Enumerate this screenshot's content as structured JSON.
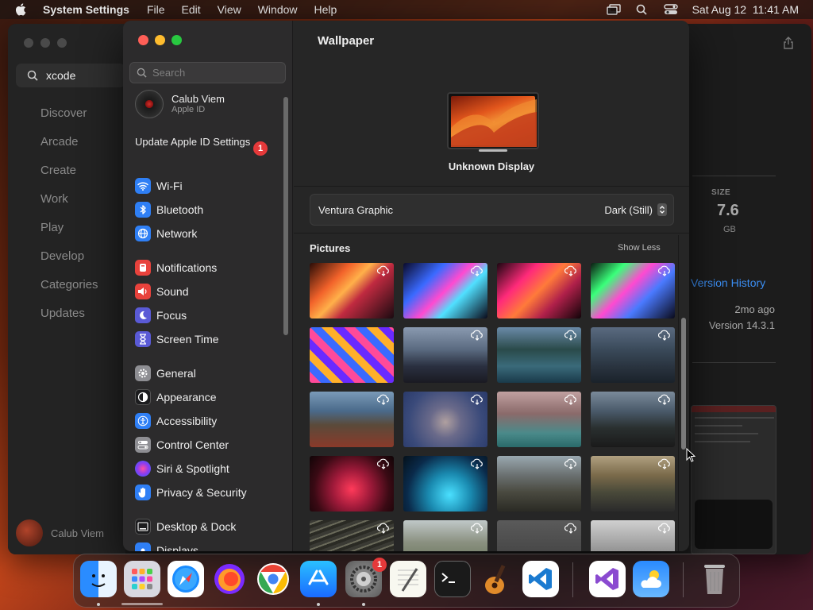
{
  "menubar": {
    "app_name": "System Settings",
    "menus": [
      "File",
      "Edit",
      "View",
      "Window",
      "Help"
    ],
    "datetime": "Sat Aug 12  11:41 AM"
  },
  "appstore": {
    "search_value": "xcode",
    "nav": [
      "Discover",
      "Arcade",
      "Create",
      "Work",
      "Play",
      "Develop",
      "Categories",
      "Updates"
    ],
    "user_name": "Calub Viem",
    "size_label": "SIZE",
    "size_value": "7.6",
    "size_unit": "GB",
    "version_history": "Version History",
    "updated_ago": "2mo ago",
    "version": "Version 14.3.1"
  },
  "settings": {
    "search_placeholder": "Search",
    "user": {
      "name": "Calub Viem",
      "sub": "Apple ID"
    },
    "update_label": "Update Apple ID Settings",
    "update_badge": "1",
    "groups": [
      [
        {
          "label": "Wi-Fi",
          "icon": "wifi-icon",
          "color": "#2f7ff5"
        },
        {
          "label": "Bluetooth",
          "icon": "bluetooth-icon",
          "color": "#2f7ff5"
        },
        {
          "label": "Network",
          "icon": "globe-icon",
          "color": "#2f7ff5"
        }
      ],
      [
        {
          "label": "Notifications",
          "icon": "bell-icon",
          "color": "#e8423c"
        },
        {
          "label": "Sound",
          "icon": "speaker-icon",
          "color": "#e8423c"
        },
        {
          "label": "Focus",
          "icon": "moon-icon",
          "color": "#5a5ad6"
        },
        {
          "label": "Screen Time",
          "icon": "hourglass-icon",
          "color": "#5a5ad6"
        }
      ],
      [
        {
          "label": "General",
          "icon": "gear-icon",
          "color": "#8e8e93"
        },
        {
          "label": "Appearance",
          "icon": "appearance-icon",
          "color": "#1c1c1e"
        },
        {
          "label": "Accessibility",
          "icon": "accessibility-icon",
          "color": "#2f7ff5"
        },
        {
          "label": "Control Center",
          "icon": "toggles-icon",
          "color": "#8e8e93"
        },
        {
          "label": "Siri & Spotlight",
          "icon": "siri-icon",
          "color": "#b03adc"
        },
        {
          "label": "Privacy & Security",
          "icon": "hand-icon",
          "color": "#2f7ff5"
        }
      ],
      [
        {
          "label": "Desktop & Dock",
          "icon": "dock-icon",
          "color": "#1c1c1e"
        },
        {
          "label": "Displays",
          "icon": "display-icon",
          "color": "#2f7ff5"
        }
      ]
    ],
    "page_title": "Wallpaper",
    "display_name": "Unknown Display",
    "wallpaper_name": "Ventura Graphic",
    "wallpaper_mode": "Dark (Still)",
    "pictures_label": "Pictures",
    "show_less": "Show Less"
  },
  "dock": {
    "apps": [
      "Finder",
      "Launchpad",
      "Safari",
      "Firefox",
      "Chrome",
      "App Store",
      "System Settings",
      "TextEdit",
      "Terminal",
      "GarageBand",
      "Visual Studio Code",
      "Visual Studio",
      "Weather",
      "Trash"
    ],
    "settings_badge": "1"
  }
}
